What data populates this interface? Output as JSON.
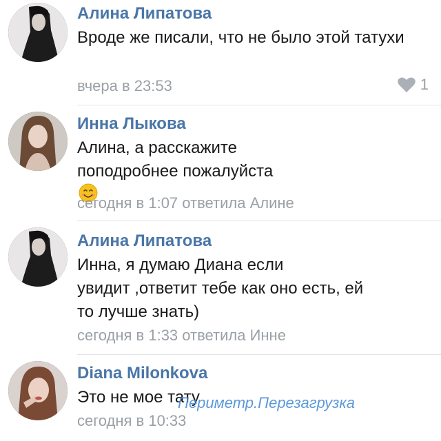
{
  "comments": [
    {
      "author": "Алина Липатова",
      "text": "Вроде же писали, что не было этой татухи",
      "meta": "вчера в 23:53",
      "likes": "1"
    },
    {
      "author": "Инна Лыкова",
      "text": "Алина, а расскажите поподробнее пожалуйста",
      "meta": "сегодня в 1:07 ответила Алине"
    },
    {
      "author": "Алина Липатова",
      "text_lines": [
        "Инна, я думаю Диана если",
        "увидит ,ответит тебе как оно есть, ей",
        "то лучше знать)"
      ],
      "meta": "сегодня в 1:33 ответила Инне"
    },
    {
      "author": "Diana Milonkova",
      "text": "Это не мое тату",
      "meta": "сегодня в 10:33"
    }
  ],
  "watermark": "Периметр.Перезагрузка",
  "icons": {
    "like": "heart-icon",
    "emoji": "smiling-face-emoji-icon"
  },
  "colors": {
    "author": "#4a76a8",
    "meta": "#9aa0a6",
    "watermark": "#4a8fd6"
  }
}
